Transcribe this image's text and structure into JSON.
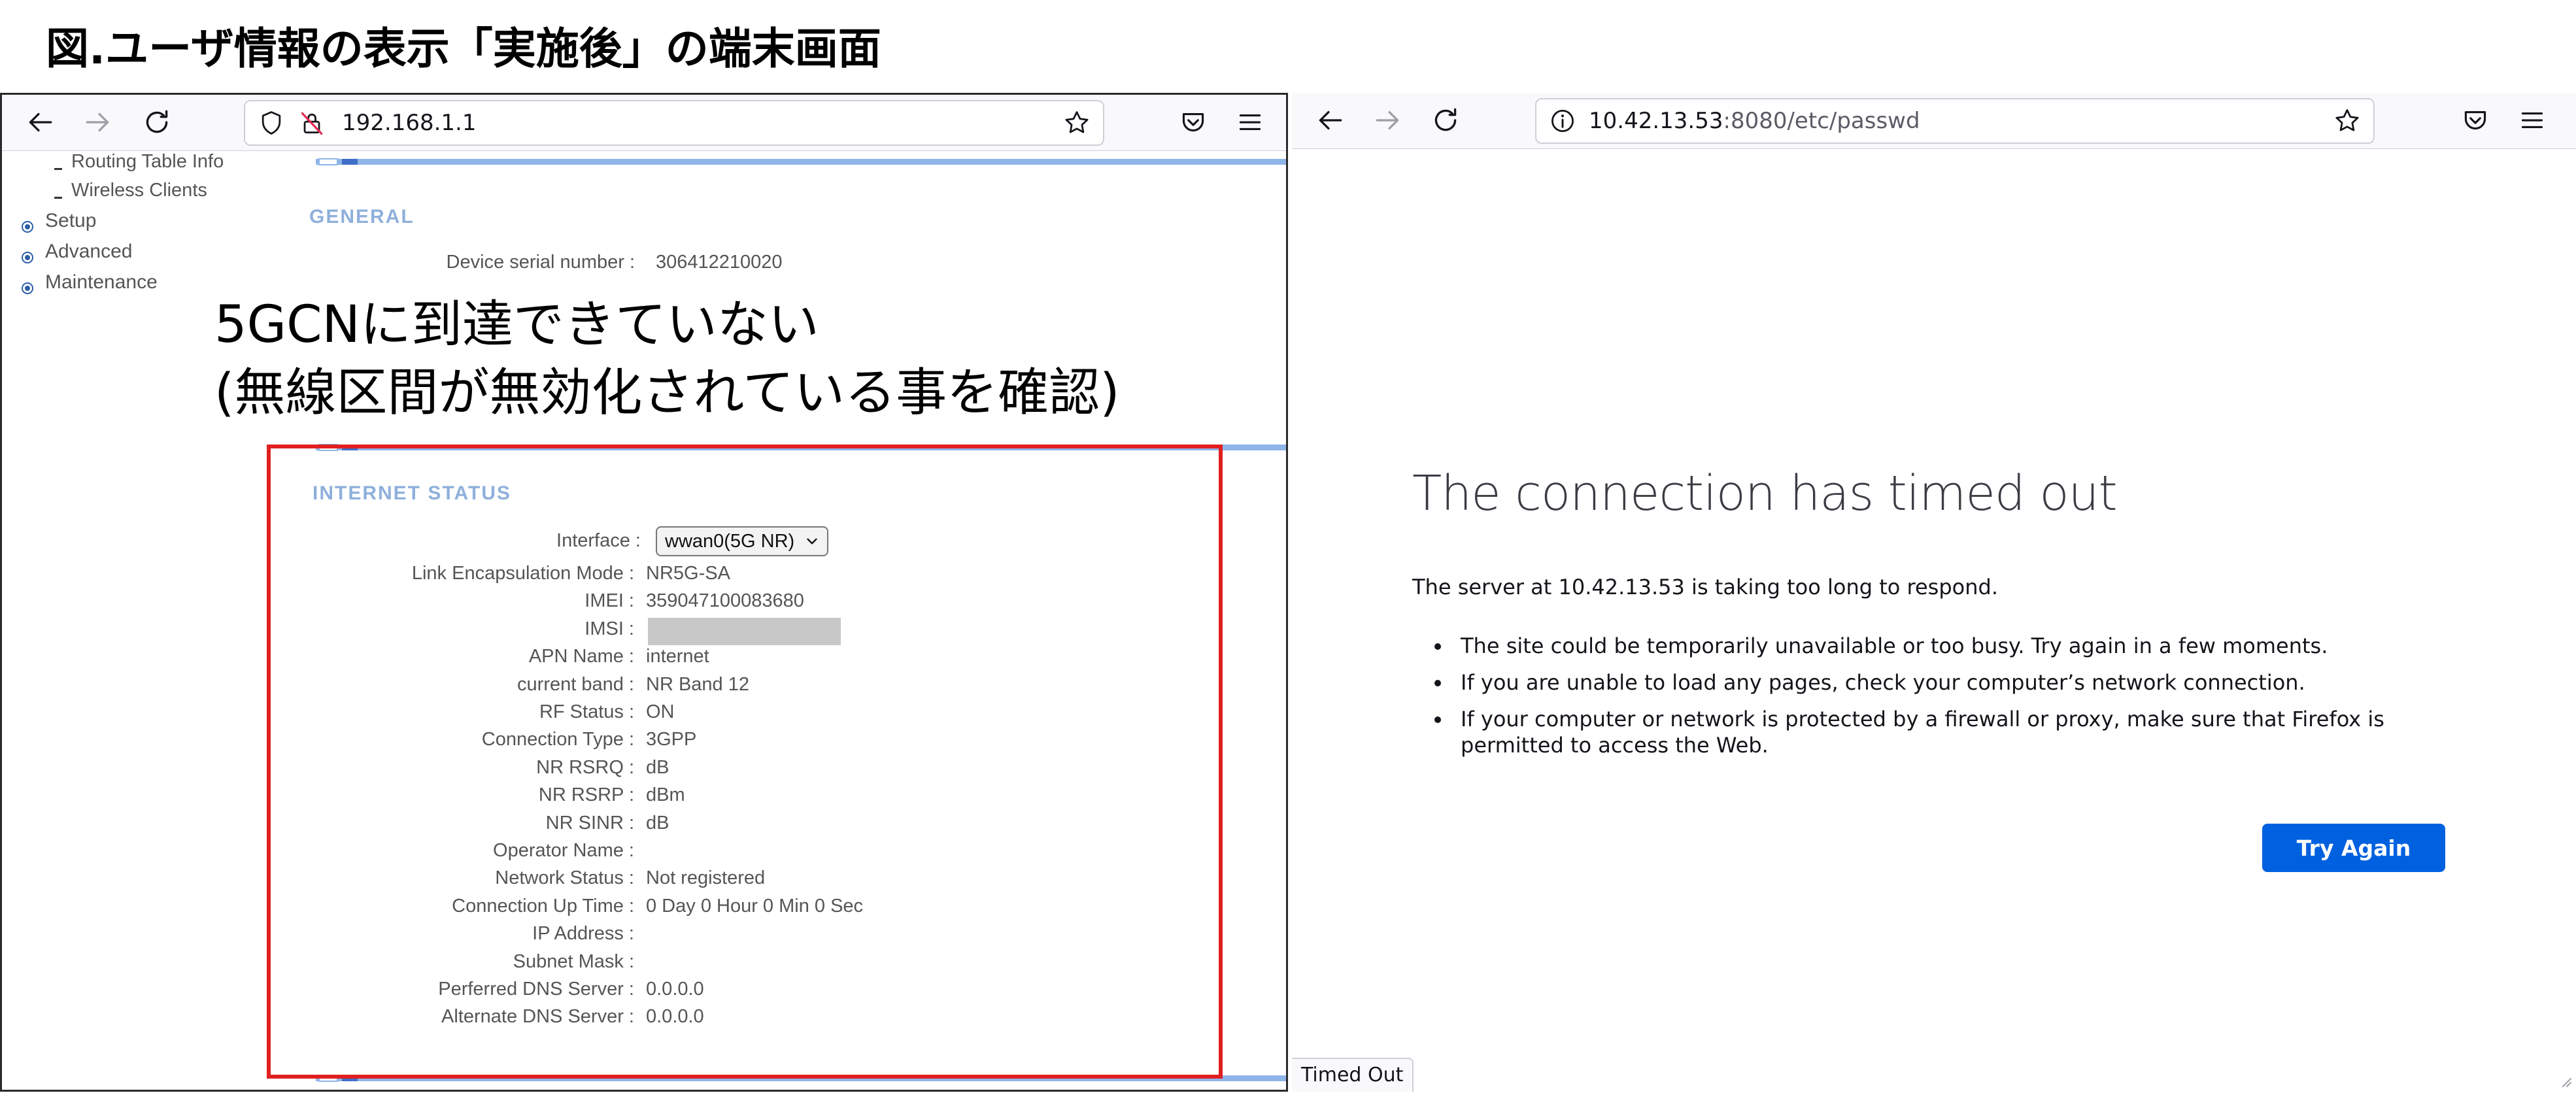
{
  "caption": "図.ユーザ情報の表示「実施後」の端末画面",
  "left_browser": {
    "url": "192.168.1.1",
    "sidebar": {
      "sub_items": [
        "Routing Table Info",
        "Wireless Clients"
      ],
      "main_items": [
        "Setup",
        "Advanced",
        "Maintenance"
      ]
    },
    "general": {
      "title": "GENERAL",
      "serial_label": "Device serial number :",
      "serial_value": "306412210020"
    },
    "annotation": {
      "line1": "5GCNに到達できていない",
      "line2": "(無線区間が無効化されている事を確認)"
    },
    "internet_status": {
      "title": "INTERNET STATUS",
      "interface_label": "Interface :",
      "interface_value": "wwan0(5G NR)",
      "rows": [
        {
          "label": "Link Encapsulation Mode :",
          "value": "NR5G-SA"
        },
        {
          "label": "IMEI :",
          "value": "359047100083680"
        },
        {
          "label": "IMSI :",
          "value": ""
        },
        {
          "label": "APN Name :",
          "value": "internet"
        },
        {
          "label": "current band :",
          "value": "NR Band 12"
        },
        {
          "label": "RF Status :",
          "value": "ON"
        },
        {
          "label": "Connection Type :",
          "value": "3GPP"
        },
        {
          "label": "NR RSRQ :",
          "value": "dB"
        },
        {
          "label": "NR RSRP :",
          "value": "dBm"
        },
        {
          "label": "NR SINR :",
          "value": "dB"
        },
        {
          "label": "Operator Name :",
          "value": ""
        },
        {
          "label": "Network Status :",
          "value": "Not registered"
        },
        {
          "label": "Connection Up Time :",
          "value": "0 Day 0 Hour 0 Min 0 Sec"
        },
        {
          "label": "IP Address :",
          "value": ""
        },
        {
          "label": "Subnet Mask :",
          "value": ""
        },
        {
          "label": "Perferred DNS Server :",
          "value": "0.0.0.0"
        },
        {
          "label": "Alternate DNS Server :",
          "value": "0.0.0.0"
        }
      ]
    }
  },
  "right_browser": {
    "url_host": "10.42.13.53",
    "url_rest": ":8080/etc/passwd",
    "error_title": "The connection has timed out",
    "error_subtitle": "The server at 10.42.13.53 is taking too long to respond.",
    "error_items": [
      "The site could be temporarily unavailable or too busy. Try again in a few moments.",
      "If you are unable to load any pages, check your computer’s network connection.",
      "If your computer or network is protected by a firewall or proxy, make sure that Firefox is permitted to access the Web."
    ],
    "try_again_label": "Try Again",
    "status_text": "Timed Out"
  },
  "colors": {
    "accent_blue": "#0061e0",
    "annotation_red": "#e02020",
    "section_title": "#8fb0dc"
  },
  "icons": [
    "back-arrow-icon",
    "forward-arrow-icon",
    "reload-icon",
    "shield-icon",
    "insecure-lock-icon",
    "info-icon",
    "star-icon",
    "pocket-icon",
    "hamburger-menu-icon"
  ]
}
